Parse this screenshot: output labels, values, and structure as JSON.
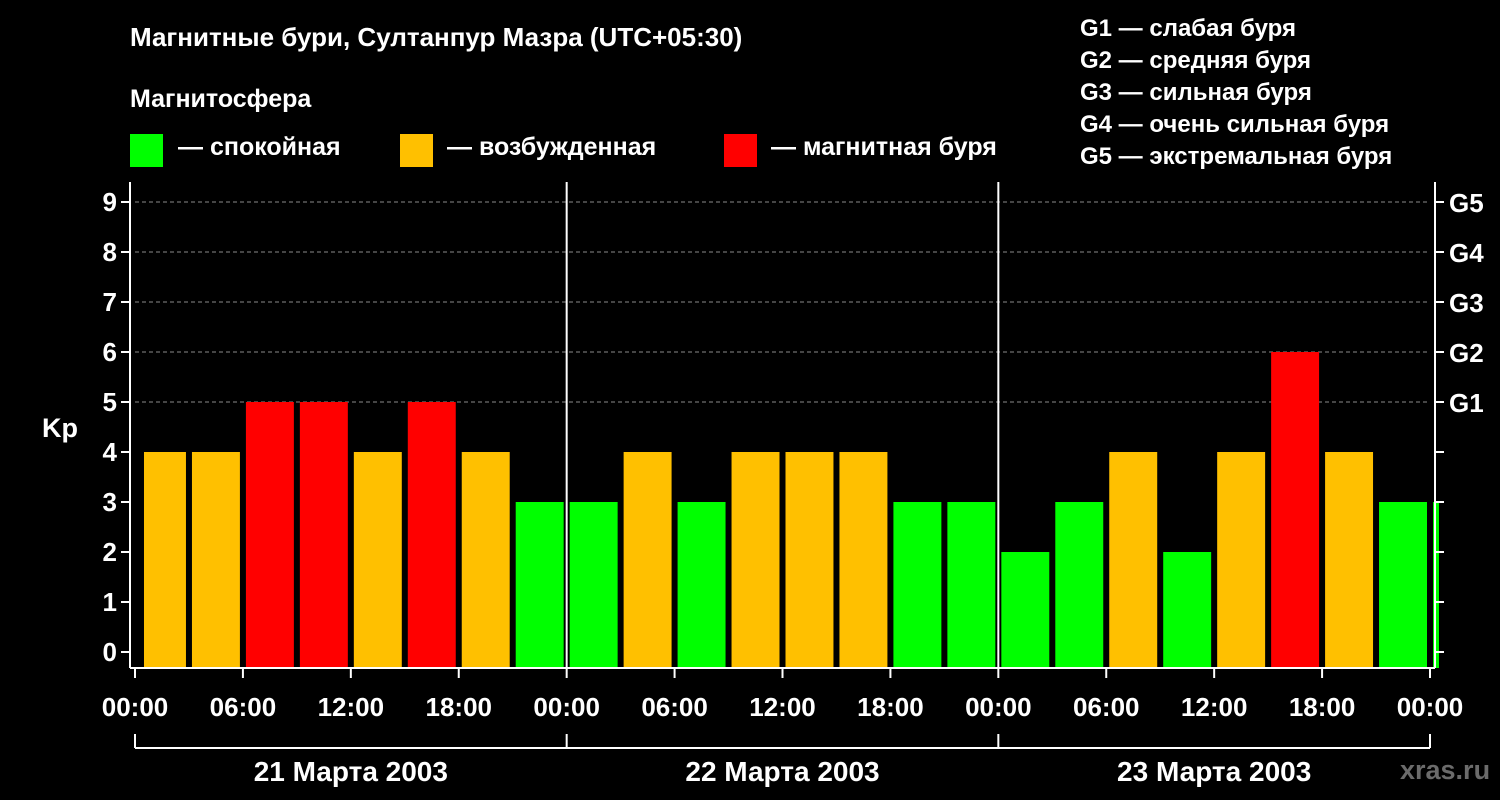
{
  "header": {
    "title": "Магнитные бури, Султанпур Мазра (UTC+05:30)",
    "magnetosphere_heading": "Магнитосфера",
    "legend": [
      {
        "label": "— спокойная",
        "color": "#00ff00"
      },
      {
        "label": "— возбужденная",
        "color": "#ffc000"
      },
      {
        "label": "— магнитная буря",
        "color": "#ff0000"
      }
    ],
    "storm_scale": [
      "G1 — слабая буря",
      "G2 — средняя буря",
      "G3 — сильная буря",
      "G4 — очень сильная буря",
      "G5 — экстремальная буря"
    ]
  },
  "watermark": "xras.ru",
  "chart_data": {
    "type": "bar",
    "title": "Магнитные бури, Султанпур Мазра (UTC+05:30)",
    "ylabel": "Kp",
    "ylim": [
      0,
      9
    ],
    "yticks": [
      "0",
      "1",
      "2",
      "3",
      "4",
      "5",
      "6",
      "7",
      "8",
      "9"
    ],
    "grid": "horizontal dashed at Kp 5–9",
    "right_axis": [
      {
        "kp": 5,
        "label": "G1"
      },
      {
        "kp": 6,
        "label": "G2"
      },
      {
        "kp": 7,
        "label": "G3"
      },
      {
        "kp": 8,
        "label": "G4"
      },
      {
        "kp": 9,
        "label": "G5"
      }
    ],
    "xtick_labels": [
      "00:00",
      "06:00",
      "12:00",
      "18:00",
      "00:00",
      "06:00",
      "12:00",
      "18:00",
      "00:00",
      "06:00",
      "12:00",
      "18:00",
      "00:00"
    ],
    "days": [
      "21 Марта 2003",
      "22 Марта 2003",
      "23 Марта 2003"
    ],
    "thresholds": {
      "quiet_max": 3,
      "storm_min": 5
    },
    "colors": {
      "quiet": "#00ff00",
      "active": "#ffc000",
      "storm": "#ff0000"
    },
    "bars": [
      {
        "start": 0.5,
        "end": 3.0,
        "kp": 4
      },
      {
        "start": 3.0,
        "end": 6.0,
        "kp": 4
      },
      {
        "start": 6.0,
        "end": 9.0,
        "kp": 5
      },
      {
        "start": 9.0,
        "end": 12.0,
        "kp": 5
      },
      {
        "start": 12.0,
        "end": 15.0,
        "kp": 4
      },
      {
        "start": 15.0,
        "end": 18.0,
        "kp": 5
      },
      {
        "start": 18.0,
        "end": 21.0,
        "kp": 4
      },
      {
        "start": 21.0,
        "end": 24.0,
        "kp": 3
      },
      {
        "start": 24.0,
        "end": 27.0,
        "kp": 3
      },
      {
        "start": 27.0,
        "end": 30.0,
        "kp": 4
      },
      {
        "start": 30.0,
        "end": 33.0,
        "kp": 3
      },
      {
        "start": 33.0,
        "end": 36.0,
        "kp": 4
      },
      {
        "start": 36.0,
        "end": 39.0,
        "kp": 4
      },
      {
        "start": 39.0,
        "end": 42.0,
        "kp": 4
      },
      {
        "start": 42.0,
        "end": 45.0,
        "kp": 3
      },
      {
        "start": 45.0,
        "end": 48.0,
        "kp": 3
      },
      {
        "start": 48.0,
        "end": 51.0,
        "kp": 2
      },
      {
        "start": 51.0,
        "end": 54.0,
        "kp": 3
      },
      {
        "start": 54.0,
        "end": 57.0,
        "kp": 4
      },
      {
        "start": 57.0,
        "end": 60.0,
        "kp": 2
      },
      {
        "start": 60.0,
        "end": 63.0,
        "kp": 4
      },
      {
        "start": 63.0,
        "end": 66.0,
        "kp": 6
      },
      {
        "start": 66.0,
        "end": 69.0,
        "kp": 4
      },
      {
        "start": 69.0,
        "end": 72.0,
        "kp": 3
      },
      {
        "start": 72.0,
        "end": 72.5,
        "kp": 3
      }
    ]
  }
}
